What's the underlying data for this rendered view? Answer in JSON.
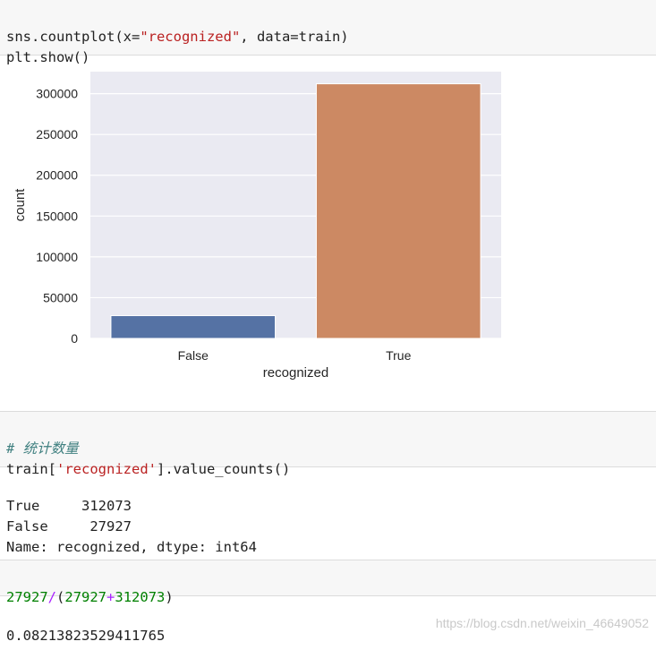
{
  "cell1": {
    "line1_a": "sns.countplot(x=",
    "line1_str": "\"recognized\"",
    "line1_b": ", data=train)",
    "line2": "plt.show()"
  },
  "chart_data": {
    "type": "bar",
    "categories": [
      "False",
      "True"
    ],
    "values": [
      27927,
      312073
    ],
    "bar_colors": [
      "#5572a4",
      "#cc8963"
    ],
    "xlabel": "recognized",
    "ylabel": "count",
    "yticks": [
      0,
      50000,
      100000,
      150000,
      200000,
      250000,
      300000
    ],
    "ylim": [
      0,
      327000
    ],
    "grid": true,
    "background": "#eaeaf2"
  },
  "cell2": {
    "comment": "# 统计数量",
    "line_a": "train[",
    "line_str": "'recognized'",
    "line_b": "].value_counts()"
  },
  "out2": {
    "row1": "True     312073",
    "row2": "False     27927",
    "row3": "Name: recognized, dtype: int64"
  },
  "cell3": {
    "n1": "27927",
    "op1": "/",
    "p1": "(",
    "n2": "27927",
    "op2": "+",
    "n3": "312073",
    "p2": ")"
  },
  "out3": {
    "value": "0.08213823529411765"
  },
  "watermark": "https://blog.csdn.net/weixin_46649052"
}
